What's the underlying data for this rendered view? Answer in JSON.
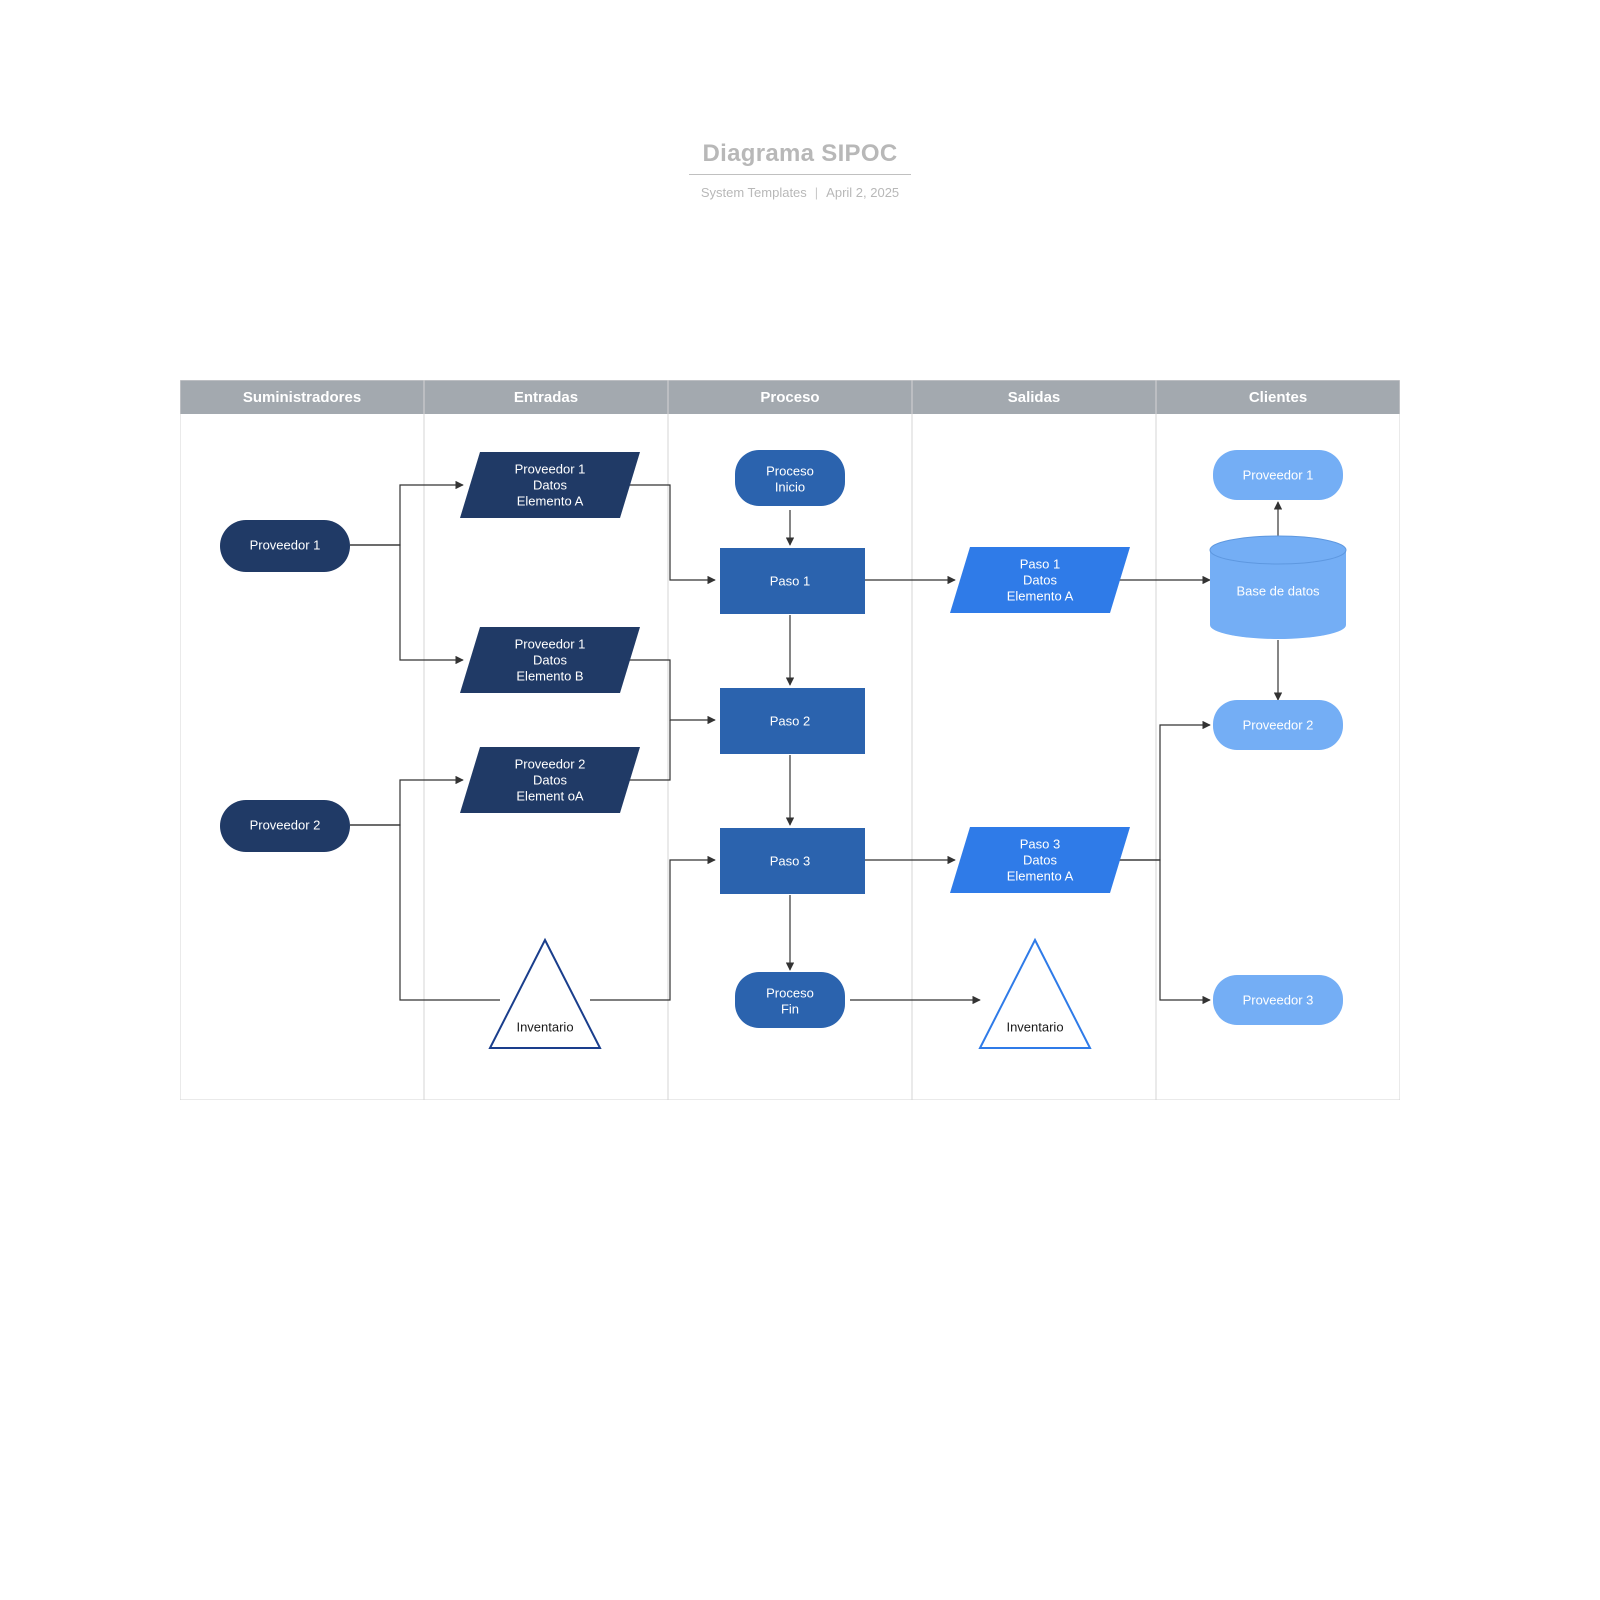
{
  "title": "Diagrama SIPOC",
  "meta_author": "System Templates",
  "meta_date": "April 2, 2025",
  "columns": {
    "suppliers": "Suministradores",
    "inputs": "Entradas",
    "process": "Proceso",
    "outputs": "Salidas",
    "customers": "Clientes"
  },
  "nodes": {
    "supplier1": "Proveedor 1",
    "supplier2": "Proveedor 2",
    "input1_l1": "Proveedor 1",
    "input1_l2": "Datos",
    "input1_l3": "Elemento A",
    "input2_l1": "Proveedor 1",
    "input2_l2": "Datos",
    "input2_l3": "Elemento B",
    "input3_l1": "Proveedor 2",
    "input3_l2": "Datos",
    "input3_l3": "Element oA",
    "inventory_in": "Inventario",
    "proc_start_l1": "Proceso",
    "proc_start_l2": "Inicio",
    "step1": "Paso 1",
    "step2": "Paso 2",
    "step3": "Paso 3",
    "proc_end_l1": "Proceso",
    "proc_end_l2": "Fin",
    "output1_l1": "Paso 1",
    "output1_l2": "Datos",
    "output1_l3": "Elemento A",
    "output3_l1": "Paso 3",
    "output3_l2": "Datos",
    "output3_l3": "Elemento A",
    "inventory_out": "Inventario",
    "cust1": "Proveedor 1",
    "database": "Base de datos",
    "cust2": "Proveedor 2",
    "cust3": "Proveedor 3"
  },
  "colors": {
    "dark": "#203a66",
    "mid": "#2b63ae",
    "bright": "#2f7be8",
    "light": "#74aef5"
  }
}
